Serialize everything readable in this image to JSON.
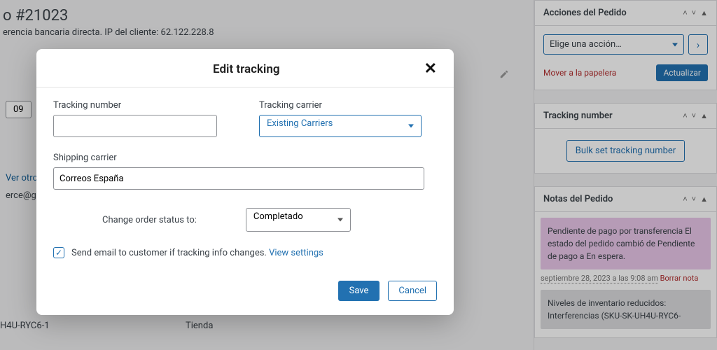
{
  "bg": {
    "order_title": "o #21023",
    "order_sub": "erencia bancaria directa. IP del cliente: 62.122.228.8",
    "date_value": "09",
    "view_others": "Ver otros",
    "email": "erce@gr",
    "sku": "H4U-RYC6-1",
    "store": "Tienda"
  },
  "sidebar": {
    "actions": {
      "title": "Acciones del Pedido",
      "select_label": "Elige una acción…",
      "go_glyph": "›",
      "trash": "Mover a la papelera",
      "update": "Actualizar"
    },
    "tracking": {
      "title": "Tracking number",
      "bulk_btn": "Bulk set tracking number"
    },
    "notes": {
      "title": "Notas del Pedido",
      "note1": "Pendiente de pago por transferencia El estado del pedido cambió de Pendiente de pago a En espera.",
      "note1_time": "septiembre 28, 2023 a las 9:08 am",
      "note1_delete": "Borrar nota",
      "note2": "Niveles de inventario reducidos: Interferencias (SKU-SK-UH4U-RYC6-"
    }
  },
  "modal": {
    "title": "Edit tracking",
    "tracking_number_label": "Tracking number",
    "tracking_number_value": "",
    "tracking_carrier_label": "Tracking carrier",
    "tracking_carrier_value": "Existing Carriers",
    "shipping_carrier_label": "Shipping carrier",
    "shipping_carrier_value": "Correos España",
    "status_label": "Change order status to:",
    "status_value": "Completado",
    "email_checkbox_label": "Send email to customer if tracking info changes.",
    "view_settings": "View settings",
    "email_checked": true,
    "save": "Save",
    "cancel": "Cancel"
  }
}
